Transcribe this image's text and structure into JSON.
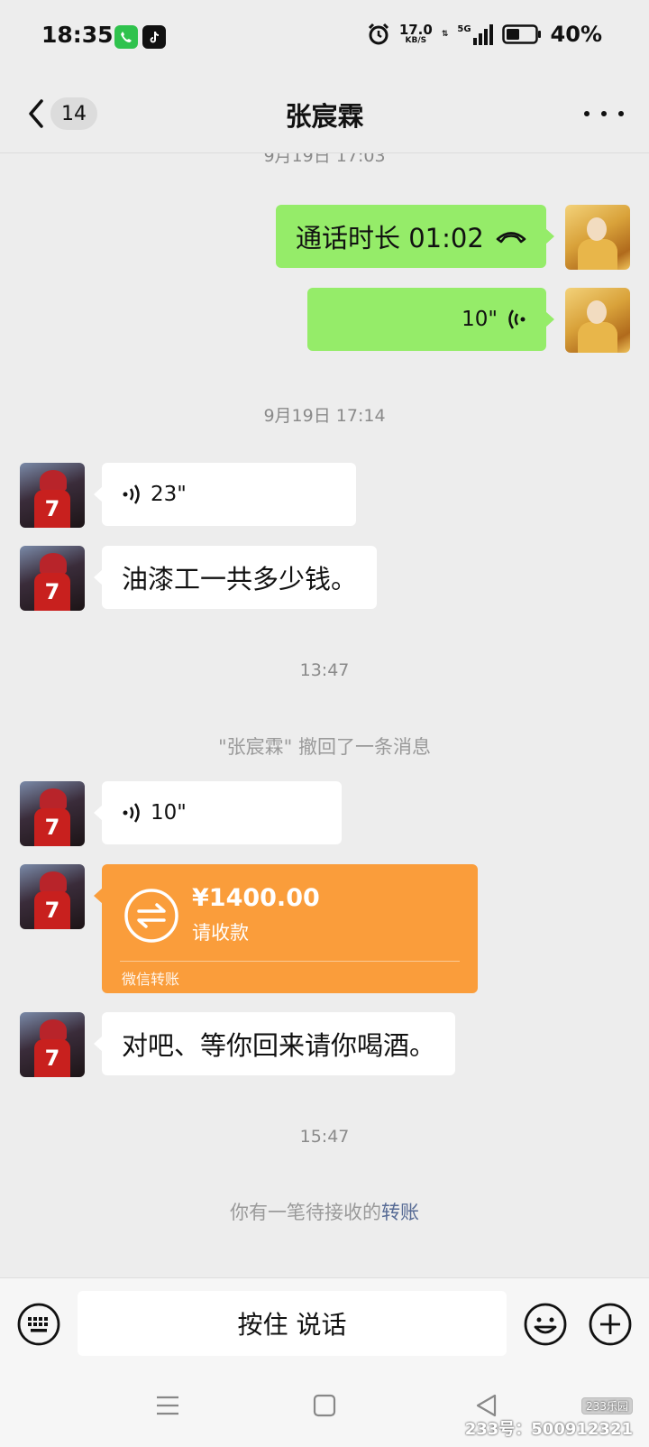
{
  "status_bar": {
    "time": "18:35",
    "net_speed_value": "17.0",
    "net_speed_unit": "KB/S",
    "signal_label": "5G",
    "battery_percent": "40%"
  },
  "nav": {
    "unread_count": "14",
    "title": "张宸霖"
  },
  "messages": {
    "ts1": "9月19日 17:03",
    "call_duration": "通话时长 01:02",
    "voice_sent": "10\"",
    "ts2": "9月19日 17:14",
    "voice_recv1": "23\"",
    "text1": "油漆工一共多少钱。",
    "ts3": "13:47",
    "recall_notice": "\"张宸霖\" 撤回了一条消息",
    "voice_recv2": "10\"",
    "transfer": {
      "amount": "¥1400.00",
      "status": "请收款",
      "footer": "微信转账"
    },
    "text2": "对吧、等你回来请你喝酒。",
    "ts4": "15:47",
    "pending_notice": "你有一笔待接收的",
    "pending_link": "转账"
  },
  "input_bar": {
    "hold_to_talk": "按住 说话"
  },
  "watermark": {
    "logo": "233乐园",
    "text": "233号：500912321"
  },
  "colors": {
    "sent_bubble": "#95ec69",
    "received_bubble": "#ffffff",
    "transfer_card": "#fa9d3b",
    "link": "#576b95"
  }
}
